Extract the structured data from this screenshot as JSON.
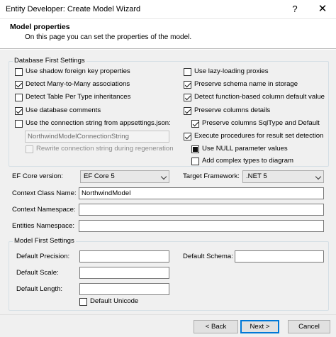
{
  "window": {
    "title": "Entity Developer: Create Model Wizard",
    "help_label": "?",
    "close_label": "✕"
  },
  "header": {
    "title": "Model properties",
    "subtitle": "On this page you can set the properties of the model."
  },
  "database_first": {
    "legend": "Database First Settings",
    "left": [
      {
        "label": "Use shadow foreign key properties",
        "checked": false
      },
      {
        "label": "Detect Many-to-Many associations",
        "checked": true
      },
      {
        "label": "Detect Table Per Type inheritances",
        "checked": false
      },
      {
        "label": "Use database comments",
        "checked": true
      },
      {
        "label": "Use the connection string from appsettings.json:",
        "checked": false
      }
    ],
    "connection_string_value": "NorthwindModelConnectionString",
    "rewrite_label": "Rewrite connection string during regeneration",
    "right": [
      {
        "label": "Use lazy-loading proxies",
        "checked": false
      },
      {
        "label": "Preserve schema name in storage",
        "checked": true
      },
      {
        "label": "Detect function-based column default value",
        "checked": true
      },
      {
        "label": "Preserve columns details",
        "checked": true
      },
      {
        "label": "Preserve columns SqlType and Default",
        "checked": true
      },
      {
        "label": "Execute procedures for result set detection",
        "checked": true
      },
      {
        "label": "Use NULL parameter values",
        "checked": true
      },
      {
        "label": "Add complex types to diagram",
        "checked": false
      }
    ]
  },
  "ef_core_version": {
    "label": "EF Core version:",
    "value": "EF Core 5"
  },
  "target_framework": {
    "label": "Target Framework:",
    "value": ".NET 5"
  },
  "context_class_name": {
    "label": "Context Class Name:",
    "value": "NorthwindModel"
  },
  "context_namespace": {
    "label": "Context Namespace:",
    "value": ""
  },
  "entities_namespace": {
    "label": "Entities Namespace:",
    "value": ""
  },
  "model_first": {
    "legend": "Model First Settings",
    "default_precision": {
      "label": "Default Precision:",
      "value": ""
    },
    "default_scale": {
      "label": "Default Scale:",
      "value": ""
    },
    "default_length": {
      "label": "Default Length:",
      "value": ""
    },
    "default_schema": {
      "label": "Default Schema:",
      "value": ""
    },
    "default_unicode": {
      "label": "Default Unicode",
      "checked": false
    }
  },
  "buttons": {
    "back": "< Back",
    "next": "Next >",
    "cancel": "Cancel"
  }
}
